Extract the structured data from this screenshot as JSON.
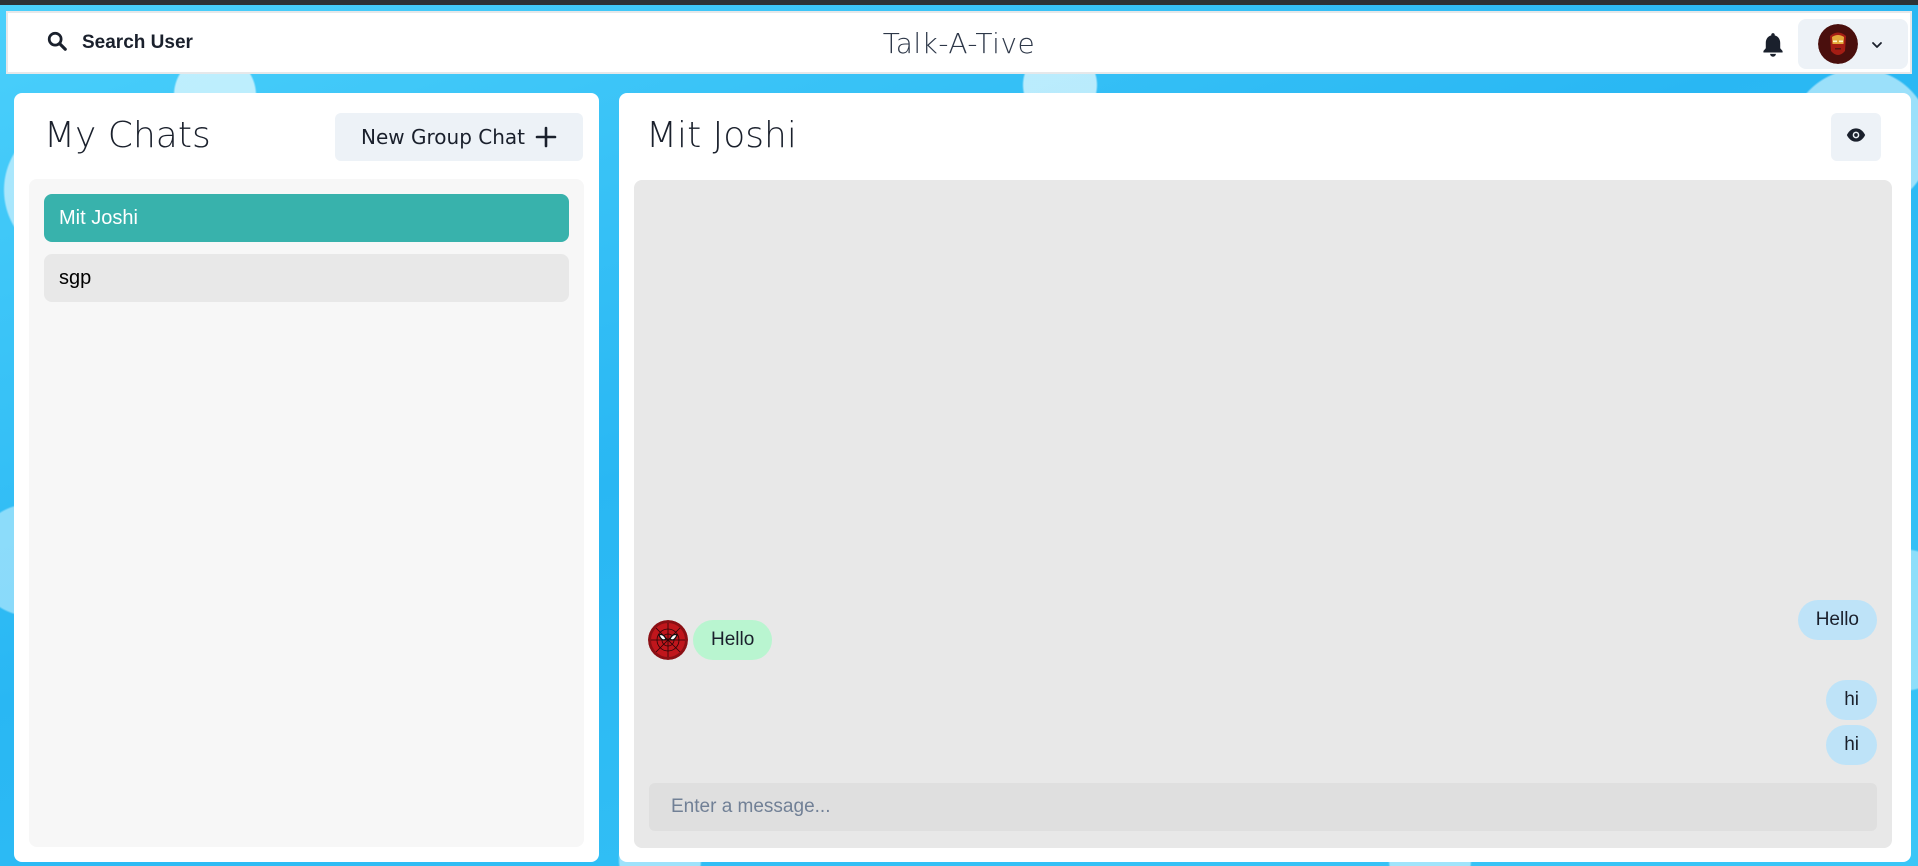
{
  "header": {
    "search_label": "Search User",
    "app_title": "Talk-A-Tive",
    "search_icon": "search-icon",
    "notification_icon": "bell-icon",
    "profile_avatar": "iron-man-avatar",
    "menu_chevron": "chevron-down-icon"
  },
  "sidebar": {
    "title": "My Chats",
    "new_group_label": "New Group Chat",
    "new_group_icon": "plus-icon",
    "chats": [
      {
        "name": "Mit Joshi",
        "active": true
      },
      {
        "name": "sgp",
        "active": false
      }
    ]
  },
  "chat": {
    "title": "Mit Joshi",
    "view_profile_icon": "eye-icon",
    "messages": [
      {
        "text": "Hello",
        "sender": "me"
      },
      {
        "text": "Hello",
        "sender": "Mit Joshi",
        "avatar": "spider-man-avatar"
      },
      {
        "text": "hi",
        "sender": "me"
      },
      {
        "text": "hi",
        "sender": "me"
      }
    ],
    "input_placeholder": "Enter a message..."
  },
  "colors": {
    "active_chat": "#38B2AC",
    "my_bubble": "#BEE3F8",
    "their_bubble": "#B9F5D0",
    "background": "#36C2F5"
  }
}
